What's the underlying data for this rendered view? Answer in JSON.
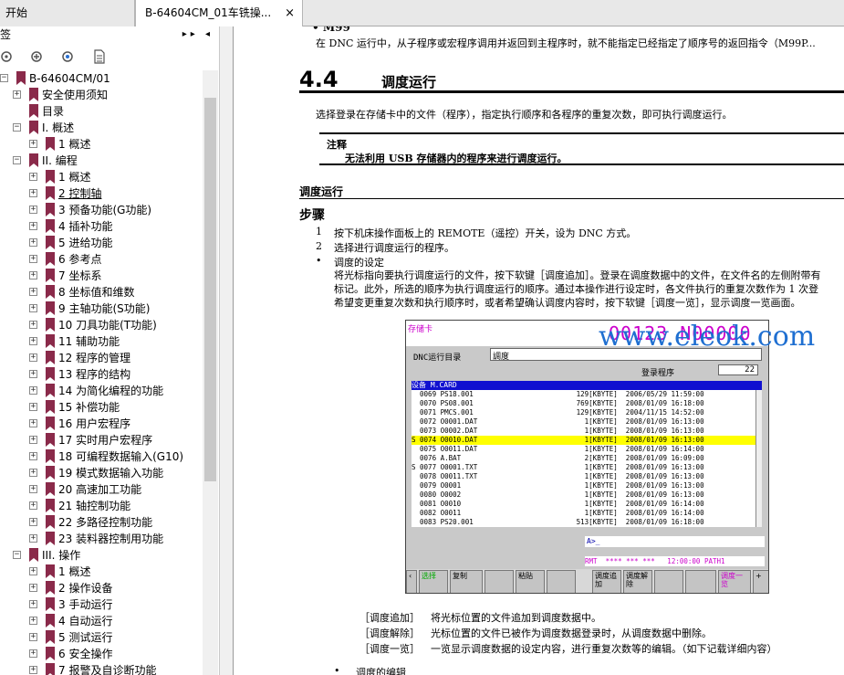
{
  "tabs": {
    "home": "开始",
    "doc": "B-64604CM_01车铣操...",
    "close": "×"
  },
  "bookmarks_panel": {
    "title": "签",
    "collapse_glyph": "▸▸ ◂",
    "toolbar_icons": [
      "bookmark-options-icon",
      "expand-bookmark-icon",
      "add-bookmark-icon",
      "page-bookmark-icon"
    ],
    "items": [
      {
        "label": "B-64604CM/01",
        "level": 0,
        "exp": "-"
      },
      {
        "label": "安全使用须知",
        "level": 1,
        "exp": "+"
      },
      {
        "label": "目录",
        "level": 1,
        "exp": ""
      },
      {
        "label": "I. 概述",
        "level": 1,
        "exp": "-"
      },
      {
        "label": "1 概述",
        "level": 2,
        "exp": "+"
      },
      {
        "label": "II. 编程",
        "level": 1,
        "exp": "-"
      },
      {
        "label": "1 概述",
        "level": 2,
        "exp": "+"
      },
      {
        "label": "2 控制轴",
        "level": 2,
        "exp": "+",
        "underline": true
      },
      {
        "label": "3 预备功能(G功能)",
        "level": 2,
        "exp": "+"
      },
      {
        "label": "4 插补功能",
        "level": 2,
        "exp": "+"
      },
      {
        "label": "5 进给功能",
        "level": 2,
        "exp": "+"
      },
      {
        "label": "6 参考点",
        "level": 2,
        "exp": "+"
      },
      {
        "label": "7 坐标系",
        "level": 2,
        "exp": "+"
      },
      {
        "label": "8 坐标值和维数",
        "level": 2,
        "exp": "+"
      },
      {
        "label": "9 主轴功能(S功能)",
        "level": 2,
        "exp": "+"
      },
      {
        "label": "10 刀具功能(T功能)",
        "level": 2,
        "exp": "+"
      },
      {
        "label": "11 辅助功能",
        "level": 2,
        "exp": "+"
      },
      {
        "label": "12 程序的管理",
        "level": 2,
        "exp": "+"
      },
      {
        "label": "13 程序的结构",
        "level": 2,
        "exp": "+"
      },
      {
        "label": "14 为简化编程的功能",
        "level": 2,
        "exp": "+"
      },
      {
        "label": "15 补偿功能",
        "level": 2,
        "exp": "+"
      },
      {
        "label": "16 用户宏程序",
        "level": 2,
        "exp": "+"
      },
      {
        "label": "17 实时用户宏程序",
        "level": 2,
        "exp": "+"
      },
      {
        "label": "18 可编程数据输入(G10)",
        "level": 2,
        "exp": "+"
      },
      {
        "label": "19 模式数据输入功能",
        "level": 2,
        "exp": "+"
      },
      {
        "label": "20 高速加工功能",
        "level": 2,
        "exp": "+"
      },
      {
        "label": "21 轴控制功能",
        "level": 2,
        "exp": "+"
      },
      {
        "label": "22 多路径控制功能",
        "level": 2,
        "exp": "+"
      },
      {
        "label": "23 装料器控制用功能",
        "level": 2,
        "exp": "+"
      },
      {
        "label": "III. 操作",
        "level": 1,
        "exp": "-"
      },
      {
        "label": "1 概述",
        "level": 2,
        "exp": "+"
      },
      {
        "label": "2 操作设备",
        "level": 2,
        "exp": "+"
      },
      {
        "label": "3 手动运行",
        "level": 2,
        "exp": "+"
      },
      {
        "label": "4 自动运行",
        "level": 2,
        "exp": "+"
      },
      {
        "label": "5 测试运行",
        "level": 2,
        "exp": "+"
      },
      {
        "label": "6 安全操作",
        "level": 2,
        "exp": "+"
      },
      {
        "label": "7 报警及自诊断功能",
        "level": 2,
        "exp": "+"
      }
    ]
  },
  "doc": {
    "m99_title": "• M99",
    "m99_text": "在 DNC 运行中，从子程序或宏程序调用并返回到主程序时，就不能指定已经指定了顺序号的返回指令（M99P...",
    "section_number": "4.4",
    "section_title": "调度运行",
    "intro": "选择登录在存储卡中的文件（程序），指定执行顺序和各程序的重复次数，即可执行调度运行。",
    "note_label": "注释",
    "note_text": "无法利用 USB 存储器内的程序来进行调度运行。",
    "sub_heading": "调度运行",
    "steps_heading": "步骤",
    "steps": [
      {
        "mark": "1",
        "text": "按下机床操作面板上的 REMOTE（遥控）开关，设为 DNC 方式。"
      },
      {
        "mark": "2",
        "text": "选择进行调度运行的程序。"
      },
      {
        "mark": "•",
        "text": "调度的设定"
      }
    ],
    "step_para": [
      "将光标指向要执行调度运行的文件，按下软键［调度追加］。登录在调度数据中的文件，在文件名的左侧附带有",
      "标记。此外，所选的顺序为执行调度运行的顺序。通过本操作进行设定时，各文件执行的重复次数作为 1 次登",
      "希望变更重复次数和执行顺序时，或者希望确认调度内容时，按下软键［调度一览］，显示调度一览画面。"
    ],
    "softkey_desc": [
      {
        "key": "［调度追加］",
        "text": "将光标位置的文件追加到调度数据中。"
      },
      {
        "key": "［调度解除］",
        "text": "光标位置的文件已被作为调度数据登录时，从调度数据中删除。"
      },
      {
        "key": "［调度一览］",
        "text": "一览显示调度数据的设定内容，进行重复次数等的编辑。（如下记载详细内容）"
      }
    ],
    "last_bullet": "•",
    "last_text": "调度的编辑"
  },
  "cnc": {
    "card_label": "存储卡",
    "o_number": "O0123 N00000",
    "dnc_label": "DNC运行目录",
    "dnc_value": "調度",
    "reg_label": "登录程序",
    "reg_count": "22",
    "device_row": "设备  M.CARD",
    "files": [
      {
        "s": " ",
        "no": "0069",
        "name": "PS18.001",
        "size": "129[KBYTE]",
        "date": "2006/05/29",
        "time": "11:59:00"
      },
      {
        "s": " ",
        "no": "0070",
        "name": "PS08.001",
        "size": "769[KBYTE]",
        "date": "2008/01/09",
        "time": "16:18:00"
      },
      {
        "s": " ",
        "no": "0071",
        "name": "PMCS.001",
        "size": "129[KBYTE]",
        "date": "2004/11/15",
        "time": "14:52:00"
      },
      {
        "s": " ",
        "no": "0072",
        "name": "O0001.DAT",
        "size": "1[KBYTE]",
        "date": "2008/01/09",
        "time": "16:13:00"
      },
      {
        "s": " ",
        "no": "0073",
        "name": "O0002.DAT",
        "size": "1[KBYTE]",
        "date": "2008/01/09",
        "time": "16:13:00"
      },
      {
        "s": "S",
        "no": "0074",
        "name": "O0010.DAT",
        "size": "1[KBYTE]",
        "date": "2008/01/09",
        "time": "16:13:00",
        "hl": true
      },
      {
        "s": " ",
        "no": "0075",
        "name": "O0011.DAT",
        "size": "1[KBYTE]",
        "date": "2008/01/09",
        "time": "16:14:00"
      },
      {
        "s": " ",
        "no": "0076",
        "name": "A.BAT",
        "size": "2[KBYTE]",
        "date": "2008/01/09",
        "time": "16:09:00"
      },
      {
        "s": "S",
        "no": "0077",
        "name": "O0001.TXT",
        "size": "1[KBYTE]",
        "date": "2008/01/09",
        "time": "16:13:00"
      },
      {
        "s": " ",
        "no": "0078",
        "name": "O0011.TXT",
        "size": "1[KBYTE]",
        "date": "2008/01/09",
        "time": "16:13:00"
      },
      {
        "s": " ",
        "no": "0079",
        "name": "O0001",
        "size": "1[KBYTE]",
        "date": "2008/01/09",
        "time": "16:13:00"
      },
      {
        "s": " ",
        "no": "0080",
        "name": "O0002",
        "size": "1[KBYTE]",
        "date": "2008/01/09",
        "time": "16:13:00"
      },
      {
        "s": " ",
        "no": "0081",
        "name": "O0010",
        "size": "1[KBYTE]",
        "date": "2008/01/09",
        "time": "16:14:00"
      },
      {
        "s": " ",
        "no": "0082",
        "name": "O0011",
        "size": "1[KBYTE]",
        "date": "2008/01/09",
        "time": "16:14:00"
      },
      {
        "s": " ",
        "no": "0083",
        "name": "PS20.001",
        "size": "513[KBYTE]",
        "date": "2008/01/09",
        "time": "16:18:00"
      }
    ],
    "cmd_line": "A>_",
    "status": "RMT  **** *** ***   12:00:00 PATH1",
    "softkeys": [
      {
        "label": "‹",
        "color": "black"
      },
      {
        "label": "选择",
        "color": "green"
      },
      {
        "label": "复制",
        "color": "black"
      },
      {
        "label": "",
        "color": "black"
      },
      {
        "label": "粘贴",
        "color": "black"
      },
      {
        "label": "",
        "color": "black"
      },
      {
        "label": "调度追加",
        "color": "black"
      },
      {
        "label": "调度解除",
        "color": "black"
      },
      {
        "label": "",
        "color": "black"
      },
      {
        "label": "",
        "color": "black"
      },
      {
        "label": "调度一览",
        "color": "magenta"
      },
      {
        "label": "+",
        "color": "black"
      }
    ]
  },
  "watermark": "www.eleok.com",
  "colors": {
    "bookmark": "#8a2a4a",
    "highlight": "#ffff00",
    "device_bar": "#1010d0",
    "watermark": "#1f6fd1"
  }
}
